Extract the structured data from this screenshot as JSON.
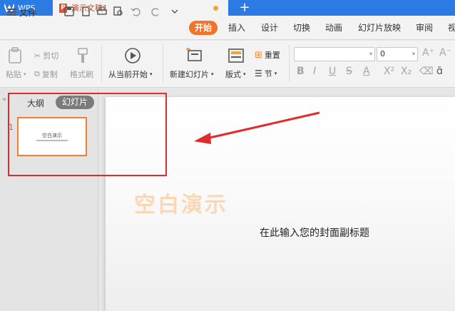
{
  "titlebar": {
    "app_name": "WPS",
    "doc_tab": "演示文稿1",
    "new_tab": "+"
  },
  "menubar": {
    "file": "文件",
    "tabs": [
      "开始",
      "插入",
      "设计",
      "切换",
      "动画",
      "幻灯片放映",
      "审阅",
      "视"
    ]
  },
  "ribbon": {
    "paste": "粘贴",
    "cut": "剪切",
    "copy": "复制",
    "format_painter": "格式刷",
    "from_current": "从当前开始",
    "new_slide": "新建幻灯片",
    "layout": "版式",
    "reset": "重置",
    "section": "节",
    "font_name": "",
    "font_size": "0",
    "format_buttons": [
      "B",
      "I",
      "U",
      "S",
      "A",
      "X²",
      "X₂"
    ]
  },
  "left_panel": {
    "tab_outline": "大纲",
    "tab_slides": "幻灯片",
    "slide_number": "1",
    "thumb_title": "空白演示"
  },
  "slide": {
    "title": "空白演示",
    "subtitle": "在此输入您的封面副标题"
  },
  "colors": {
    "accent": "#f0742c",
    "title_bar": "#2c7be5",
    "annotation": "#e02b2b"
  }
}
